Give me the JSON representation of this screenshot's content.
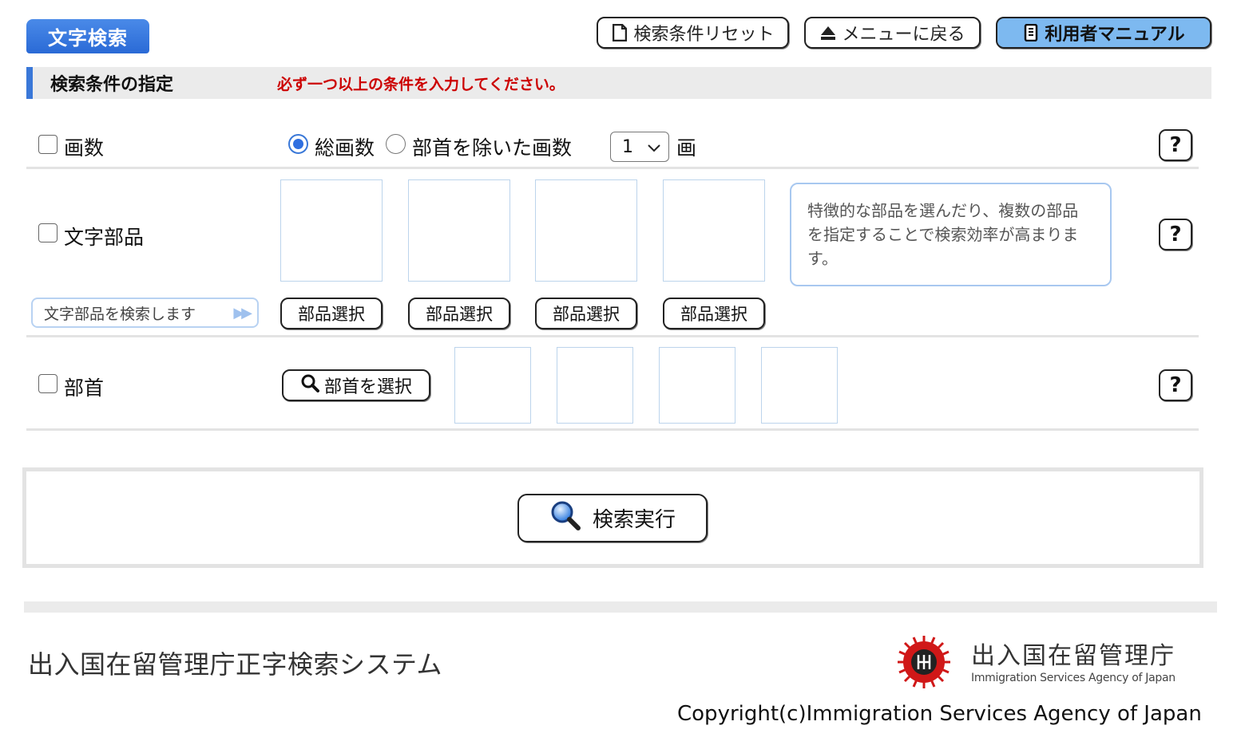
{
  "header": {
    "tab_label": "文字検索",
    "reset_label": "検索条件リセット",
    "menu_label": "メニューに戻る",
    "manual_label": "利用者マニュアル"
  },
  "section": {
    "title": "検索条件の指定",
    "warning": "必ず一つ以上の条件を入力してください。"
  },
  "stroke_row": {
    "label": "画数",
    "radio_total": "総画数",
    "radio_excl": "部首を除いた画数",
    "selected_value": "1",
    "unit": "画"
  },
  "parts_row": {
    "label": "文字部品",
    "hint": "特徴的な部品を選んだり、複数の部品を指定することで検索効率が高まります。",
    "select_label": "部品選択",
    "search_link": "文字部品を検索します"
  },
  "radical_row": {
    "label": "部首",
    "select_label": "部首を選択"
  },
  "help_label": "?",
  "execute_label": "検索実行",
  "footer": {
    "system_name": "出入国在留管理庁正字検索システム",
    "agency_name": "出入国在留管理庁",
    "agency_name_en": "Immigration Services Agency of Japan",
    "copyright": "Copyright(c)Immigration Services Agency of Japan"
  },
  "colors": {
    "accent": "#3a78d8",
    "warning": "#cc0000",
    "manual_bg": "#7db9f0"
  }
}
